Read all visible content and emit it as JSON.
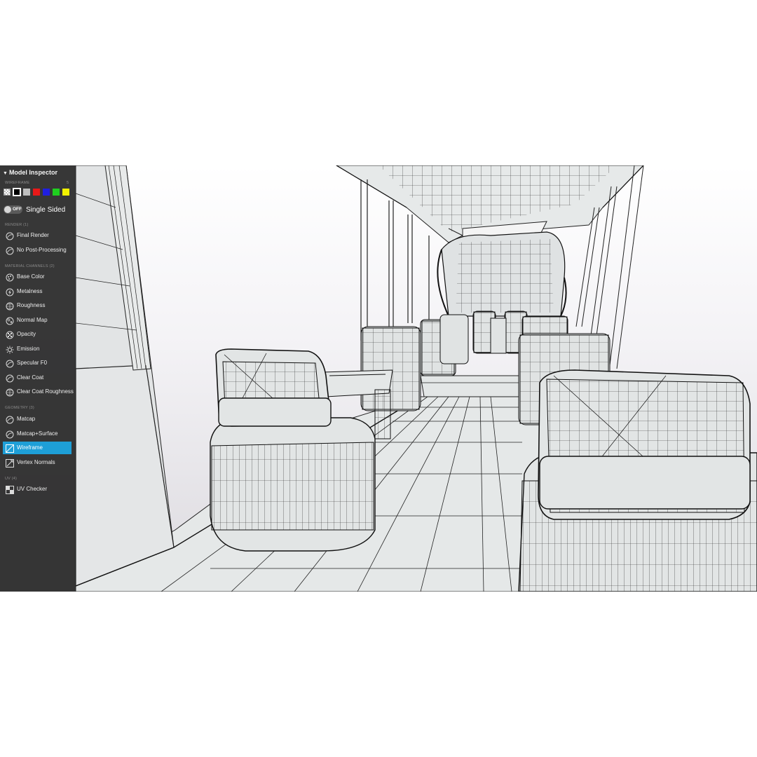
{
  "panel": {
    "title": "Model Inspector",
    "wireframe_section": "WIREFRAME",
    "wireframe_count": "5",
    "swatches": [
      {
        "name": "checker",
        "color": "checker"
      },
      {
        "name": "black",
        "color": "#000000",
        "selected": true
      },
      {
        "name": "gray",
        "color": "#c0c0c0"
      },
      {
        "name": "red",
        "color": "#e81919"
      },
      {
        "name": "blue",
        "color": "#1f1fe0"
      },
      {
        "name": "green",
        "color": "#1fcf1f"
      },
      {
        "name": "yellow",
        "color": "#f2f200"
      }
    ],
    "toggle_state": "OFF",
    "single_sided_label": "Single Sided",
    "sections": {
      "render": "RENDER (1)",
      "material": "MATERIAL CHANNELS (2)",
      "geometry": "GEOMETRY (3)",
      "uv": "UV (4)"
    },
    "render_items": [
      {
        "label": "Final Render",
        "icon": "sphere-icon"
      },
      {
        "label": "No Post-Processing",
        "icon": "sphere-icon"
      }
    ],
    "material_items": [
      {
        "label": "Base Color",
        "icon": "palette-icon"
      },
      {
        "label": "Metalness",
        "icon": "lightning-sphere-icon"
      },
      {
        "label": "Roughness",
        "icon": "dotted-sphere-icon"
      },
      {
        "label": "Normal Map",
        "icon": "normal-sphere-icon"
      },
      {
        "label": "Opacity",
        "icon": "checker-sphere-icon"
      },
      {
        "label": "Emission",
        "icon": "sun-icon"
      },
      {
        "label": "Specular F0",
        "icon": "sphere-icon"
      },
      {
        "label": "Clear Coat",
        "icon": "sphere-icon"
      },
      {
        "label": "Clear Coat Roughness",
        "icon": "dotted-sphere-icon"
      }
    ],
    "geometry_items": [
      {
        "label": "Matcap",
        "icon": "sphere-icon"
      },
      {
        "label": "Matcap+Surface",
        "icon": "sphere-icon"
      },
      {
        "label": "Wireframe",
        "icon": "wireframe-icon",
        "active": true
      },
      {
        "label": "Vertex Normals",
        "icon": "vertex-normals-icon"
      }
    ],
    "uv_items": [
      {
        "label": "UV Checker",
        "icon": "uv-checker-icon"
      }
    ]
  },
  "colors": {
    "panel_bg": "#2a2a2a",
    "accent": "#1e9fd7",
    "mesh_fill": "#e3e6e6",
    "wire": "#1a1a1a"
  }
}
